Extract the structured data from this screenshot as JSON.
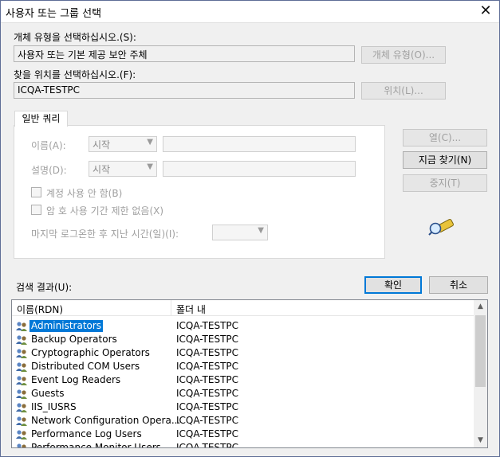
{
  "window": {
    "title": "사용자 또는 그룹 선택",
    "close_glyph": "✕"
  },
  "object_type": {
    "label": "개체 유형을 선택하십시오.(S):",
    "value": "사용자 또는 기본 제공 보안 주체",
    "button": "개체 유형(O)..."
  },
  "location": {
    "label": "찾을 위치를 선택하십시오.(F):",
    "value": "ICQA-TESTPC",
    "button": "위치(L)..."
  },
  "query": {
    "tab_label": "일반 쿼리",
    "name_label": "이름(A):",
    "name_mode": "시작",
    "desc_label": "설명(D):",
    "desc_mode": "시작",
    "disabled_accounts": "계정 사용 안 함(B)",
    "no_expire_pw": "암 호 사용 기간 제한 없음(X)",
    "days_since_logon": "마지막 로그온한 후 지난 시간(일)(I):",
    "days_value": ""
  },
  "side_buttons": {
    "columns": "열(C)...",
    "find_now": "지금 찾기(N)",
    "stop": "중지(T)"
  },
  "search_results_label": "검색 결과(U):",
  "ok_button": "확인",
  "cancel_button": "취소",
  "results": {
    "columns": [
      "이름(RDN)",
      "폴더 내"
    ],
    "rows": [
      {
        "name": "Administrators",
        "folder": "ICQA-TESTPC"
      },
      {
        "name": "Backup Operators",
        "folder": "ICQA-TESTPC"
      },
      {
        "name": "Cryptographic Operators",
        "folder": "ICQA-TESTPC"
      },
      {
        "name": "Distributed COM Users",
        "folder": "ICQA-TESTPC"
      },
      {
        "name": "Event Log Readers",
        "folder": "ICQA-TESTPC"
      },
      {
        "name": "Guests",
        "folder": "ICQA-TESTPC"
      },
      {
        "name": "IIS_IUSRS",
        "folder": "ICQA-TESTPC"
      },
      {
        "name": "Network Configuration Opera...",
        "folder": "ICQA-TESTPC"
      },
      {
        "name": "Performance Log Users",
        "folder": "ICQA-TESTPC"
      },
      {
        "name": "Performance Monitor Users",
        "folder": "ICQA-TESTPC"
      }
    ]
  },
  "colors": {
    "accent": "#0078d7",
    "disabled_text": "#a0a0a0"
  }
}
